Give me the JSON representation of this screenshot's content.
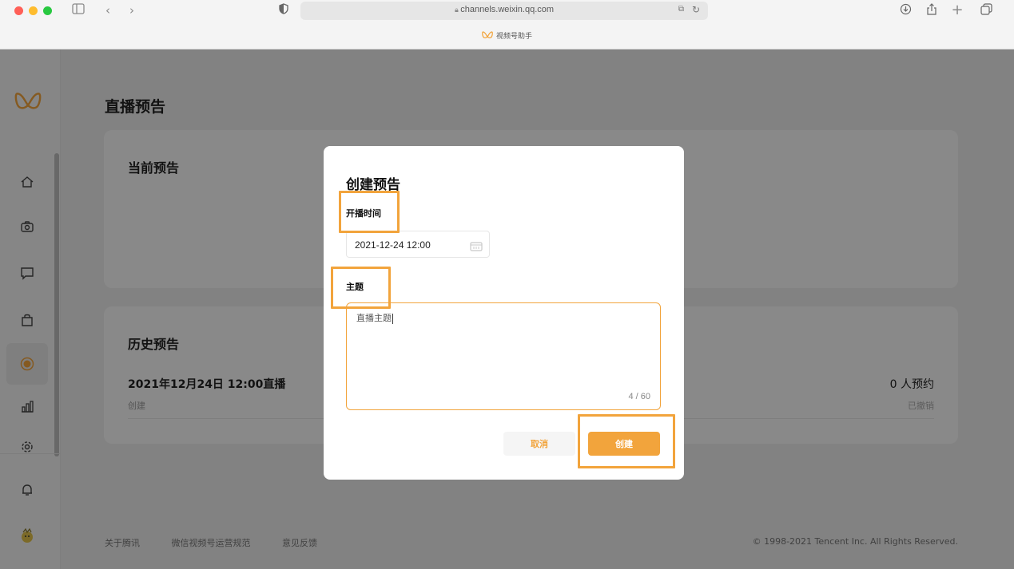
{
  "browser": {
    "url": "channels.weixin.qq.com",
    "tab_title": "视频号助手"
  },
  "colors": {
    "accent": "#f2a43c",
    "red": "#ff5f57",
    "yellow": "#febc2e",
    "green": "#28c840"
  },
  "sidebar": {
    "items": [
      {
        "icon": "home-icon"
      },
      {
        "icon": "camera-icon"
      },
      {
        "icon": "chat-icon"
      },
      {
        "icon": "bag-icon"
      },
      {
        "icon": "live-icon",
        "active": true
      },
      {
        "icon": "chart-icon"
      },
      {
        "icon": "gear-icon"
      },
      {
        "icon": "bell-icon"
      },
      {
        "icon": "avatar-icon"
      }
    ]
  },
  "page": {
    "title": "直播预告",
    "current_section": "当前预告",
    "history_section": "历史预告",
    "history": [
      {
        "title": "2021年12月24日 12:00直播",
        "sub": "创建",
        "count": "0 人预约",
        "status": "已撤销"
      }
    ]
  },
  "footer": {
    "links": [
      "关于腾讯",
      "微信视频号运营规范",
      "意见反馈"
    ],
    "copyright": "© 1998-2021 Tencent Inc. All Rights Reserved."
  },
  "modal": {
    "title": "创建预告",
    "time_label": "开播时间",
    "time_value": "2021-12-24 12:00",
    "topic_label": "主题",
    "topic_value": "直播主题",
    "topic_count": "4 / 60",
    "cancel_label": "取消",
    "create_label": "创建"
  }
}
